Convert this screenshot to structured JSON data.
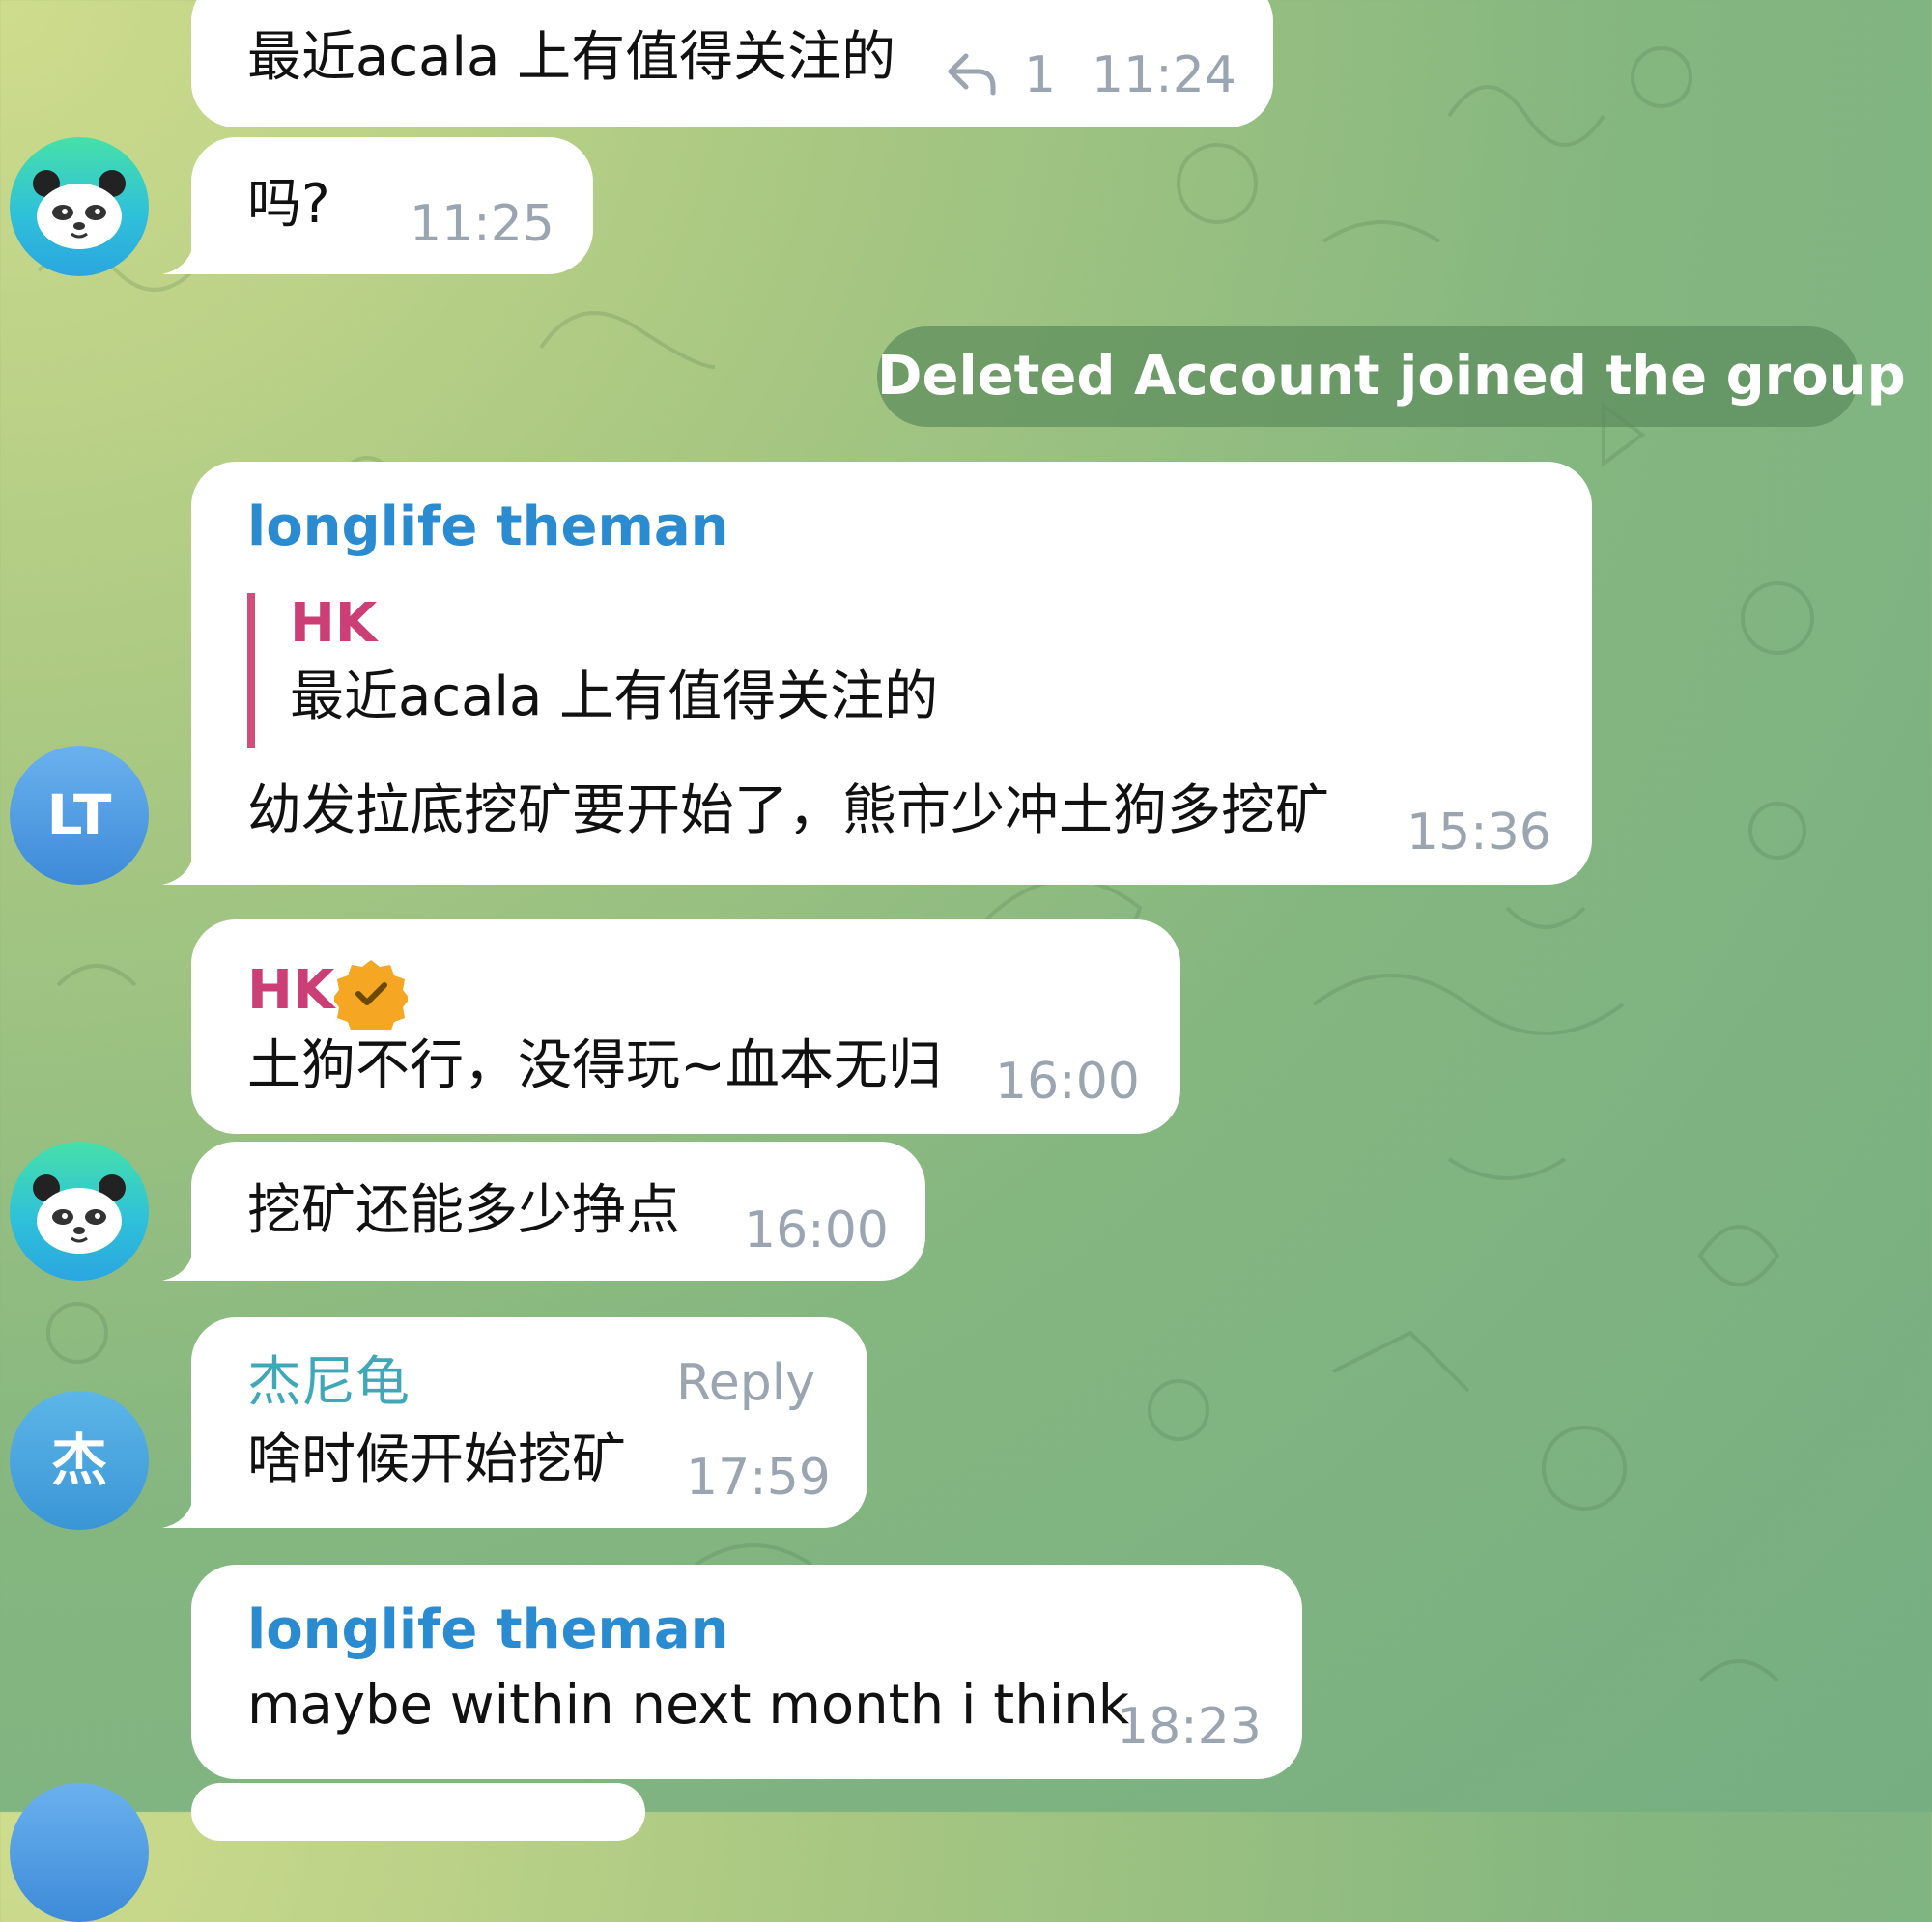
{
  "colors": {
    "sender_blue": "#2a8bd0",
    "sender_pink": "#cc3f76",
    "sender_teal": "#3fa8b8",
    "time_gray": "#9aa5b1",
    "bubble_white": "#ffffff",
    "service_pill": "#5c8c5c"
  },
  "icons": {
    "reply_arrow": "reply-icon",
    "verified": "verified-badge-icon",
    "panda_avatar": "panda-avatar-icon"
  },
  "messages": [
    {
      "text": "最近acala 上有值得关注的",
      "reply_count": "1",
      "time": "11:24"
    },
    {
      "text": "吗?",
      "time": "11:25"
    },
    {
      "service": "Deleted Account joined the group"
    },
    {
      "sender": "longlife theman",
      "quote": {
        "author": "HK",
        "text": "最近acala 上有值得关注的"
      },
      "text": "幼发拉底挖矿要开始了，熊市少冲土狗多挖矿",
      "time": "15:36",
      "avatar_initials": "LT"
    },
    {
      "sender": "HK",
      "text": "土狗不行，没得玩~血本无归",
      "time": "16:00"
    },
    {
      "text": "挖矿还能多少挣点",
      "time": "16:00"
    },
    {
      "sender": "杰尼龟",
      "action": "Reply",
      "text": "啥时候开始挖矿",
      "time": "17:59",
      "avatar_initials": "杰"
    },
    {
      "sender": "longlife theman",
      "text": "maybe within next month i think",
      "time": "18:23"
    }
  ]
}
